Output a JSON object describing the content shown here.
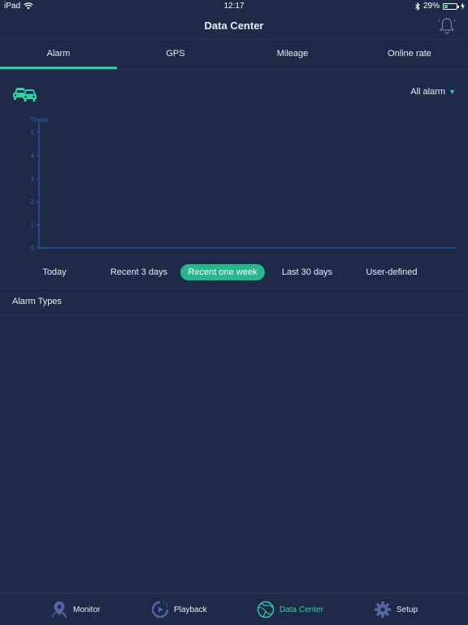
{
  "status_bar": {
    "device": "iPad",
    "time": "12:17",
    "battery": "29%",
    "battery_fraction": 0.29
  },
  "nav": {
    "title": "Data Center"
  },
  "tabs": [
    {
      "label": "Alarm",
      "active": true
    },
    {
      "label": "GPS",
      "active": false
    },
    {
      "label": "Mileage",
      "active": false
    },
    {
      "label": "Online rate",
      "active": false
    }
  ],
  "filter": {
    "label": "All alarm",
    "arrow": "▼"
  },
  "chart_data": {
    "type": "bar",
    "ylabel": "Times",
    "ylim": [
      0,
      5
    ],
    "y_ticks": [
      "0",
      "1",
      "2",
      "3",
      "4",
      "5"
    ],
    "categories": [],
    "values": [],
    "grid": false
  },
  "ranges": [
    {
      "label": "Today",
      "active": false
    },
    {
      "label": "Recent 3 days",
      "active": false
    },
    {
      "label": "Recent one week",
      "active": true
    },
    {
      "label": "Last 30 days",
      "active": false
    },
    {
      "label": "User-defined",
      "active": false
    }
  ],
  "section": {
    "alarm_types": "Alarm Types"
  },
  "bottom_nav": [
    {
      "label": "Monitor",
      "icon": "map-pin-icon",
      "active": false
    },
    {
      "label": "Playback",
      "icon": "playback-icon",
      "active": false
    },
    {
      "label": "Data Center",
      "icon": "globe-icon",
      "active": true
    },
    {
      "label": "Setup",
      "icon": "gear-icon",
      "active": false
    }
  ],
  "colors": {
    "background": "#1f2a48",
    "accent": "#2fd3a3",
    "axis": "#2b63b8",
    "button_active": "#25b88c"
  }
}
